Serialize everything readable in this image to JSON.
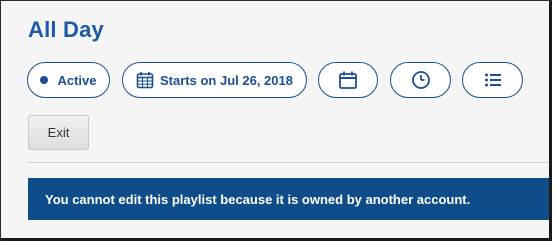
{
  "header": {
    "title": "All Day"
  },
  "status": {
    "label": "Active"
  },
  "schedule": {
    "start_label": "Starts on Jul 26, 2018"
  },
  "icons": {
    "status": "dot-icon",
    "start_date": "calendar-grid-icon",
    "date_button": "calendar-icon",
    "time_button": "clock-icon",
    "list_button": "list-icon"
  },
  "actions": {
    "exit_label": "Exit"
  },
  "alert": {
    "message": "You cannot edit this playlist because it is owned by another account."
  },
  "colors": {
    "title": "#1d5aa6",
    "pill_border": "#1c4f91",
    "alert_background": "#0f4c8a"
  }
}
